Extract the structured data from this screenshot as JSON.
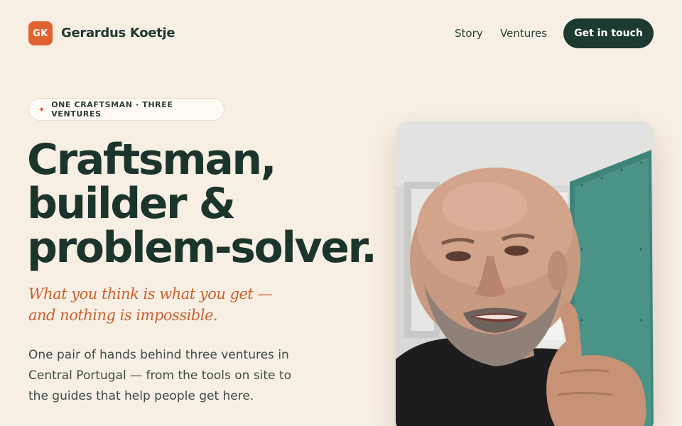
{
  "brand": {
    "badge": "GK",
    "name": "Gerardus Koetje",
    "badge_color": "#e0632f"
  },
  "nav": {
    "story": "Story",
    "ventures": "Ventures",
    "cta": "Get in touch"
  },
  "hero": {
    "eyebrow_icon": "sparkle-icon",
    "eyebrow": "ONE CRAFTSMAN · THREE VENTURES",
    "headline_lines": [
      "Craftsman,",
      "builder &",
      "problem-solver."
    ],
    "tagline": "What you think is what you get — and nothing is impossible.",
    "lead": "One pair of hands behind three ventures in Central Portugal — from the tools on site to the guides that help people get here.",
    "photo_alt": "Gerardus Koetje giving a thumbs up"
  },
  "colors": {
    "background": "#f8efe4",
    "primary": "#1c3a30",
    "accent": "#d9552a"
  }
}
